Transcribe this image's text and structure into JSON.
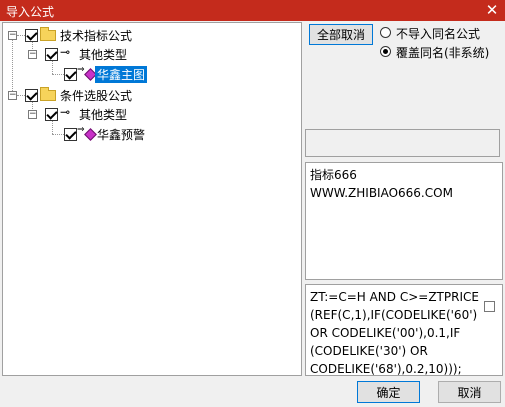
{
  "window": {
    "title": "导入公式"
  },
  "tree": {
    "items": [
      {
        "label": "技术指标公式"
      },
      {
        "label": "其他类型"
      },
      {
        "label": "华鑫主图"
      },
      {
        "label": "条件选股公式"
      },
      {
        "label": "其他类型"
      },
      {
        "label": "华鑫预警"
      }
    ]
  },
  "options": {
    "select_all_label": "全部取消",
    "radio_no_import_label": "不导入同名公式",
    "radio_overwrite_label": "覆盖同名(非系统)",
    "selected": "overwrite"
  },
  "description_text": "指标666\nWWW.ZHIBIAO666.COM",
  "formula_text": "ZT:=C=H AND C>=ZTPRICE\n(REF(C,1),IF(CODELIKE('60')\nOR CODELIKE('00'),0.1,IF\n(CODELIKE('30') OR\nCODELIKE('68'),0.2,10)));",
  "buttons": {
    "ok_label": "确定",
    "cancel_label": "取消"
  }
}
